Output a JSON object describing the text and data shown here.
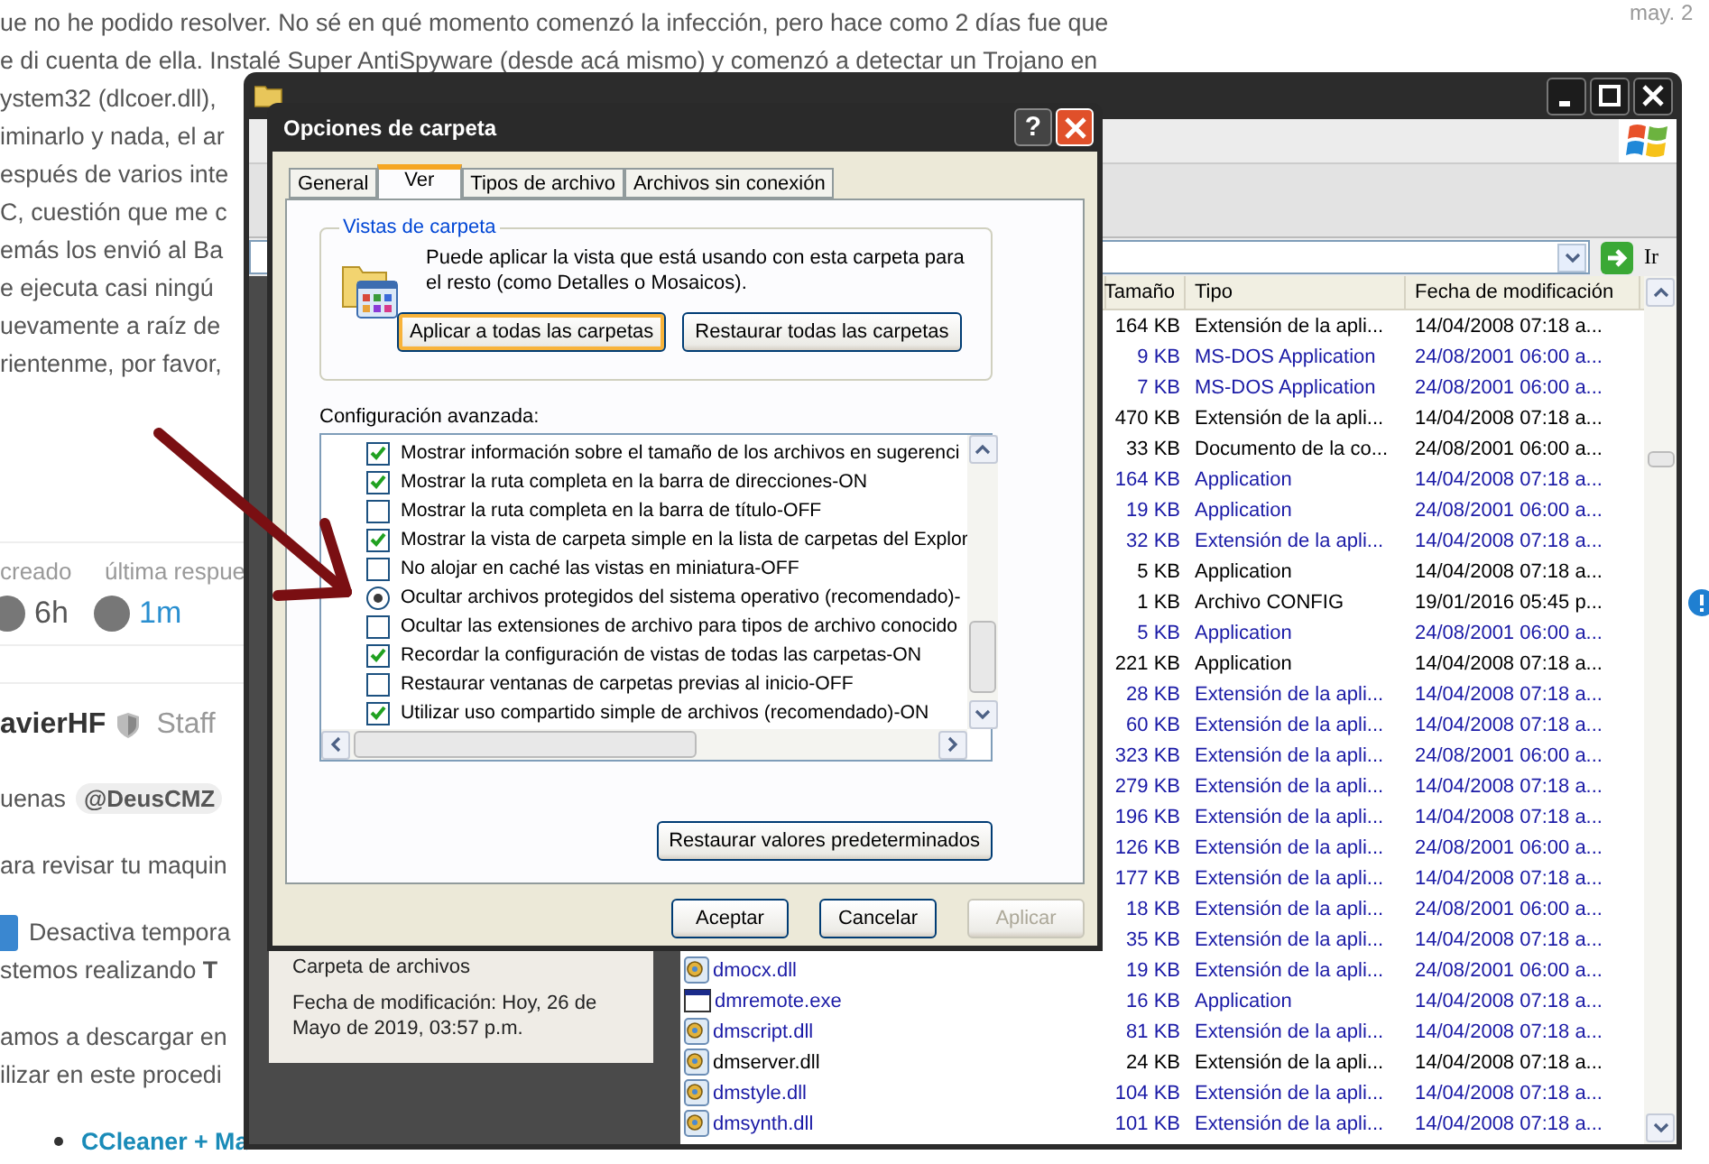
{
  "forum": {
    "date": "may. 2",
    "intro_lines": [
      "ue no he podido resolver. No sé en qué momento comenzó la infección, pero hace como 2 días fue que",
      "e di cuenta de ella. Instalé Super AntiSpyware (desde acá mismo) y comenzó a detectar un Trojano en",
      "ystem32 (dlcoer.dll),",
      "iminarlo y nada, el ar",
      "espués de varios inte",
      "C, cuestión que me c",
      "emás los envió al Ba",
      "e ejecuta casi ningú",
      "uevamente a raíz de",
      "rientenme, por favor,"
    ],
    "stats": {
      "created_label": "creado",
      "last_reply_label": "última respue",
      "created": "6h",
      "last_reply": "1m"
    },
    "reply": {
      "author": "avierHF",
      "role": "Staff",
      "paragraphs": [
        {
          "kind": "greeting",
          "lines": [
            "uenas"
          ],
          "mention": "@DeusCMZ"
        },
        {
          "kind": "text",
          "lines": [
            "ara revisar tu maquin"
          ]
        },
        {
          "kind": "step",
          "lines": [
            "Desactiva tempora",
            "stemos realizando **T**"
          ]
        },
        {
          "kind": "text",
          "lines": [
            "amos a descargar en",
            "ilizar en este procedi"
          ]
        },
        {
          "kind": "link",
          "lines": [
            "CCleaner + Ma"
          ]
        }
      ]
    }
  },
  "explorer": {
    "go_label": "Ir",
    "columns": [
      "Tamaño",
      "Tipo",
      "Fecha de modificación"
    ],
    "details": {
      "type": "Carpeta de archivos",
      "modified": "Fecha de modificación: Hoy, 26 de Mayo de 2019, 03:57 p.m."
    },
    "rows": [
      {
        "size": "164 KB",
        "type": "Extensión de la apli...",
        "date": "14/04/2008 07:18 a...",
        "compressed": false
      },
      {
        "size": "9 KB",
        "type": "MS-DOS Application",
        "date": "24/08/2001 06:00 a...",
        "compressed": true
      },
      {
        "size": "7 KB",
        "type": "MS-DOS Application",
        "date": "24/08/2001 06:00 a...",
        "compressed": true
      },
      {
        "size": "470 KB",
        "type": "Extensión de la apli...",
        "date": "14/04/2008 07:18 a...",
        "compressed": false
      },
      {
        "size": "33 KB",
        "type": "Documento de la co...",
        "date": "24/08/2001 06:00 a...",
        "compressed": false
      },
      {
        "size": "164 KB",
        "type": "Application",
        "date": "14/04/2008 07:18 a...",
        "compressed": true
      },
      {
        "size": "19 KB",
        "type": "Application",
        "date": "24/08/2001 06:00 a...",
        "compressed": true
      },
      {
        "size": "32 KB",
        "type": "Extensión de la apli...",
        "date": "14/04/2008 07:18 a...",
        "compressed": true
      },
      {
        "size": "5 KB",
        "type": "Application",
        "date": "14/04/2008 07:18 a...",
        "compressed": false
      },
      {
        "size": "1 KB",
        "type": "Archivo CONFIG",
        "date": "19/01/2016 05:45 p...",
        "compressed": false
      },
      {
        "size": "5 KB",
        "type": "Application",
        "date": "24/08/2001 06:00 a...",
        "compressed": true
      },
      {
        "size": "221 KB",
        "type": "Application",
        "date": "14/04/2008 07:18 a...",
        "compressed": false
      },
      {
        "size": "28 KB",
        "type": "Extensión de la apli...",
        "date": "14/04/2008 07:18 a...",
        "compressed": true
      },
      {
        "size": "60 KB",
        "type": "Extensión de la apli...",
        "date": "14/04/2008 07:18 a...",
        "compressed": true
      },
      {
        "size": "323 KB",
        "type": "Extensión de la apli...",
        "date": "24/08/2001 06:00 a...",
        "compressed": true
      },
      {
        "size": "279 KB",
        "type": "Extensión de la apli...",
        "date": "14/04/2008 07:18 a...",
        "compressed": true
      },
      {
        "size": "196 KB",
        "type": "Extensión de la apli...",
        "date": "14/04/2008 07:18 a...",
        "compressed": true
      },
      {
        "size": "126 KB",
        "type": "Extensión de la apli...",
        "date": "24/08/2001 06:00 a...",
        "compressed": true
      },
      {
        "size": "177 KB",
        "type": "Extensión de la apli...",
        "date": "14/04/2008 07:18 a...",
        "compressed": true
      },
      {
        "size": "18 KB",
        "type": "Extensión de la apli...",
        "date": "24/08/2001 06:00 a...",
        "compressed": true
      },
      {
        "size": "35 KB",
        "type": "Extensión de la apli...",
        "date": "14/04/2008 07:18 a...",
        "compressed": true
      },
      {
        "name": "dmocx.dll",
        "kind": "library",
        "size": "19 KB",
        "type": "Extensión de la apli...",
        "date": "24/08/2001 06:00 a...",
        "compressed": true
      },
      {
        "name": "dmremote.exe",
        "kind": "program",
        "size": "16 KB",
        "type": "Application",
        "date": "14/04/2008 07:18 a...",
        "compressed": true
      },
      {
        "name": "dmscript.dll",
        "kind": "library",
        "size": "81 KB",
        "type": "Extensión de la apli...",
        "date": "14/04/2008 07:18 a...",
        "compressed": true
      },
      {
        "name": "dmserver.dll",
        "kind": "library",
        "size": "24 KB",
        "type": "Extensión de la apli...",
        "date": "14/04/2008 07:18 a...",
        "compressed": false
      },
      {
        "name": "dmstyle.dll",
        "kind": "library",
        "size": "104 KB",
        "type": "Extensión de la apli...",
        "date": "14/04/2008 07:18 a...",
        "compressed": true
      },
      {
        "name": "dmsynth.dll",
        "kind": "library",
        "size": "101 KB",
        "type": "Extensión de la apli...",
        "date": "14/04/2008 07:18 a...",
        "compressed": true
      }
    ]
  },
  "dialog": {
    "title": "Opciones de carpeta",
    "help": "?",
    "tabs": [
      {
        "label": "General",
        "selected": false
      },
      {
        "label": "Ver",
        "selected": true
      },
      {
        "label": "Tipos de archivo",
        "selected": false
      },
      {
        "label": "Archivos sin conexión",
        "selected": false
      }
    ],
    "group": {
      "title": "Vistas de carpeta",
      "text": "Puede aplicar la vista que está usando con esta carpeta para el resto (como Detalles o Mosaicos).",
      "buttons": [
        {
          "label": "Aplicar a todas las carpetas",
          "focused": true
        },
        {
          "label": "Restaurar todas las carpetas",
          "focused": false
        }
      ]
    },
    "advanced_label": "Configuración avanzada:",
    "settings": [
      {
        "kind": "checkbox",
        "label": "Mostrar información sobre el tamaño de los archivos en sugerenci",
        "checked": true
      },
      {
        "kind": "checkbox",
        "label": "Mostrar la ruta completa en la barra de direcciones-ON",
        "checked": true
      },
      {
        "kind": "checkbox",
        "label": "Mostrar la ruta completa en la barra de título-OFF",
        "checked": false
      },
      {
        "kind": "checkbox",
        "label": "Mostrar la vista de carpeta simple en la lista de carpetas del Explor",
        "checked": true
      },
      {
        "kind": "checkbox",
        "label": "No alojar en caché las vistas en miniatura-OFF",
        "checked": false
      },
      {
        "kind": "radio",
        "label": "Ocultar archivos protegidos del sistema operativo (recomendado)-",
        "selected": true
      },
      {
        "kind": "checkbox",
        "label": "Ocultar las extensiones de archivo para tipos de archivo conocido",
        "checked": false
      },
      {
        "kind": "checkbox",
        "label": "Recordar la configuración de vistas de todas las carpetas-ON",
        "checked": true
      },
      {
        "kind": "checkbox",
        "label": "Restaurar ventanas de carpetas previas al inicio-OFF",
        "checked": false
      },
      {
        "kind": "checkbox",
        "label": "Utilizar uso compartido simple de archivos (recomendado)-ON",
        "checked": true
      }
    ],
    "restore_defaults": "Restaurar valores predeterminados",
    "footer_buttons": [
      {
        "label": "Aceptar",
        "disabled": false
      },
      {
        "label": "Cancelar",
        "disabled": false
      },
      {
        "label": "Aplicar",
        "disabled": true
      }
    ]
  }
}
